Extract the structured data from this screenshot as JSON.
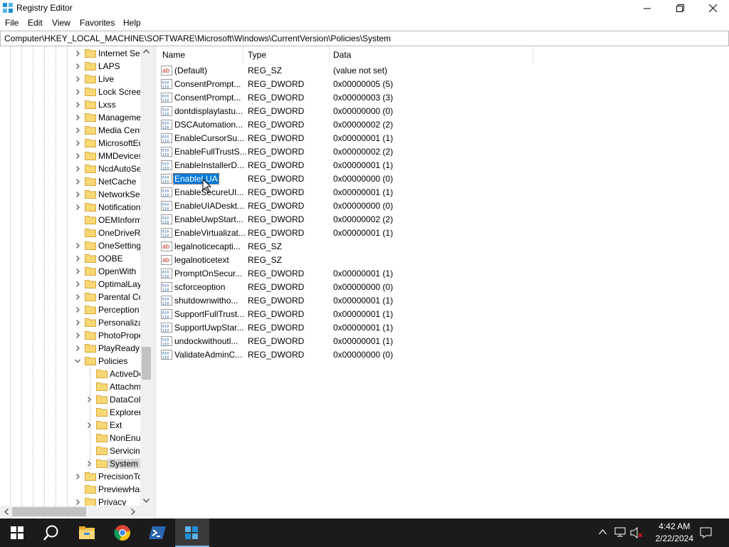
{
  "window": {
    "title": "Registry Editor"
  },
  "menu": [
    "File",
    "Edit",
    "View",
    "Favorites",
    "Help"
  ],
  "address": "Computer\\HKEY_LOCAL_MACHINE\\SOFTWARE\\Microsoft\\Windows\\CurrentVersion\\Policies\\System",
  "tree": [
    {
      "label": "Internet Set",
      "expander": "collapsed",
      "level": 0
    },
    {
      "label": "LAPS",
      "expander": "collapsed",
      "level": 0
    },
    {
      "label": "Live",
      "expander": "collapsed",
      "level": 0
    },
    {
      "label": "Lock Screen",
      "expander": "collapsed",
      "level": 0
    },
    {
      "label": "Lxss",
      "expander": "collapsed",
      "level": 0
    },
    {
      "label": "Manageme",
      "expander": "collapsed",
      "level": 0
    },
    {
      "label": "Media Cent",
      "expander": "collapsed",
      "level": 0
    },
    {
      "label": "MicrosoftEd",
      "expander": "collapsed",
      "level": 0
    },
    {
      "label": "MMDevices",
      "expander": "collapsed",
      "level": 0
    },
    {
      "label": "NcdAutoSe",
      "expander": "collapsed",
      "level": 0
    },
    {
      "label": "NetCache",
      "expander": "collapsed",
      "level": 0
    },
    {
      "label": "NetworkSer",
      "expander": "collapsed",
      "level": 0
    },
    {
      "label": "Notification",
      "expander": "collapsed",
      "level": 0
    },
    {
      "label": "OEMInform",
      "expander": "none",
      "level": 0
    },
    {
      "label": "OneDriveRa",
      "expander": "none",
      "level": 0
    },
    {
      "label": "OneSetting",
      "expander": "collapsed",
      "level": 0
    },
    {
      "label": "OOBE",
      "expander": "collapsed",
      "level": 0
    },
    {
      "label": "OpenWith",
      "expander": "collapsed",
      "level": 0
    },
    {
      "label": "OptimalLay",
      "expander": "collapsed",
      "level": 0
    },
    {
      "label": "Parental Co",
      "expander": "collapsed",
      "level": 0
    },
    {
      "label": "Perception",
      "expander": "collapsed",
      "level": 0
    },
    {
      "label": "Personaliza",
      "expander": "collapsed",
      "level": 0
    },
    {
      "label": "PhotoPrope",
      "expander": "collapsed",
      "level": 0
    },
    {
      "label": "PlayReady",
      "expander": "collapsed",
      "level": 0
    },
    {
      "label": "Policies",
      "expander": "expanded",
      "level": 0
    },
    {
      "label": "ActiveDe",
      "expander": "none",
      "level": 1
    },
    {
      "label": "Attachm",
      "expander": "none",
      "level": 1
    },
    {
      "label": "DataCol",
      "expander": "collapsed",
      "level": 1
    },
    {
      "label": "Explorer",
      "expander": "none",
      "level": 1
    },
    {
      "label": "Ext",
      "expander": "collapsed",
      "level": 1
    },
    {
      "label": "NonEnu",
      "expander": "none",
      "level": 1
    },
    {
      "label": "Servicing",
      "expander": "none",
      "level": 1
    },
    {
      "label": "System",
      "expander": "collapsed",
      "level": 1,
      "selected": true
    },
    {
      "label": "PrecisionTo",
      "expander": "collapsed",
      "level": 0
    },
    {
      "label": "PreviewHar",
      "expander": "none",
      "level": 0
    },
    {
      "label": "Privacy",
      "expander": "collapsed",
      "level": 0
    }
  ],
  "columns": {
    "name": "Name",
    "type": "Type",
    "data": "Data"
  },
  "values": [
    {
      "name": "(Default)",
      "type": "REG_SZ",
      "data": "(value not set)",
      "icon": "string-value-icon"
    },
    {
      "name": "ConsentPrompt...",
      "type": "REG_DWORD",
      "data": "0x00000005 (5)",
      "icon": "binary-value-icon"
    },
    {
      "name": "ConsentPrompt...",
      "type": "REG_DWORD",
      "data": "0x00000003 (3)",
      "icon": "binary-value-icon"
    },
    {
      "name": "dontdisplaylastu...",
      "type": "REG_DWORD",
      "data": "0x00000000 (0)",
      "icon": "binary-value-icon"
    },
    {
      "name": "DSCAutomation...",
      "type": "REG_DWORD",
      "data": "0x00000002 (2)",
      "icon": "binary-value-icon"
    },
    {
      "name": "EnableCursorSu...",
      "type": "REG_DWORD",
      "data": "0x00000001 (1)",
      "icon": "binary-value-icon"
    },
    {
      "name": "EnableFullTrustS...",
      "type": "REG_DWORD",
      "data": "0x00000002 (2)",
      "icon": "binary-value-icon"
    },
    {
      "name": "EnableInstallerD...",
      "type": "REG_DWORD",
      "data": "0x00000001 (1)",
      "icon": "binary-value-icon"
    },
    {
      "name": "EnableLUA",
      "type": "REG_DWORD",
      "data": "0x00000000 (0)",
      "icon": "binary-value-icon",
      "selected": true
    },
    {
      "name": "EnableSecureUI...",
      "type": "REG_DWORD",
      "data": "0x00000001 (1)",
      "icon": "binary-value-icon"
    },
    {
      "name": "EnableUIADeskt...",
      "type": "REG_DWORD",
      "data": "0x00000000 (0)",
      "icon": "binary-value-icon"
    },
    {
      "name": "EnableUwpStart...",
      "type": "REG_DWORD",
      "data": "0x00000002 (2)",
      "icon": "binary-value-icon"
    },
    {
      "name": "EnableVirtualizat...",
      "type": "REG_DWORD",
      "data": "0x00000001 (1)",
      "icon": "binary-value-icon"
    },
    {
      "name": "legalnoticecapti...",
      "type": "REG_SZ",
      "data": "",
      "icon": "string-value-icon"
    },
    {
      "name": "legalnoticetext",
      "type": "REG_SZ",
      "data": "",
      "icon": "string-value-icon"
    },
    {
      "name": "PromptOnSecur...",
      "type": "REG_DWORD",
      "data": "0x00000001 (1)",
      "icon": "binary-value-icon"
    },
    {
      "name": "scforceoption",
      "type": "REG_DWORD",
      "data": "0x00000000 (0)",
      "icon": "binary-value-icon"
    },
    {
      "name": "shutdownwitho...",
      "type": "REG_DWORD",
      "data": "0x00000001 (1)",
      "icon": "binary-value-icon"
    },
    {
      "name": "SupportFullTrust...",
      "type": "REG_DWORD",
      "data": "0x00000001 (1)",
      "icon": "binary-value-icon"
    },
    {
      "name": "SupportUwpStar...",
      "type": "REG_DWORD",
      "data": "0x00000001 (1)",
      "icon": "binary-value-icon"
    },
    {
      "name": "undockwithoutl...",
      "type": "REG_DWORD",
      "data": "0x00000001 (1)",
      "icon": "binary-value-icon"
    },
    {
      "name": "ValidateAdminC...",
      "type": "REG_DWORD",
      "data": "0x00000000 (0)",
      "icon": "binary-value-icon"
    }
  ],
  "taskbar": {
    "apps": [
      "start-icon",
      "search-icon",
      "file-explorer-icon",
      "chrome-icon",
      "powershell-icon",
      "registry-editor-icon"
    ],
    "time": "4:42 AM",
    "date": "2/22/2024"
  },
  "colors": {
    "selection": "#0078d7",
    "taskbar": "#1b1b1b",
    "folder": "#f8d775"
  }
}
